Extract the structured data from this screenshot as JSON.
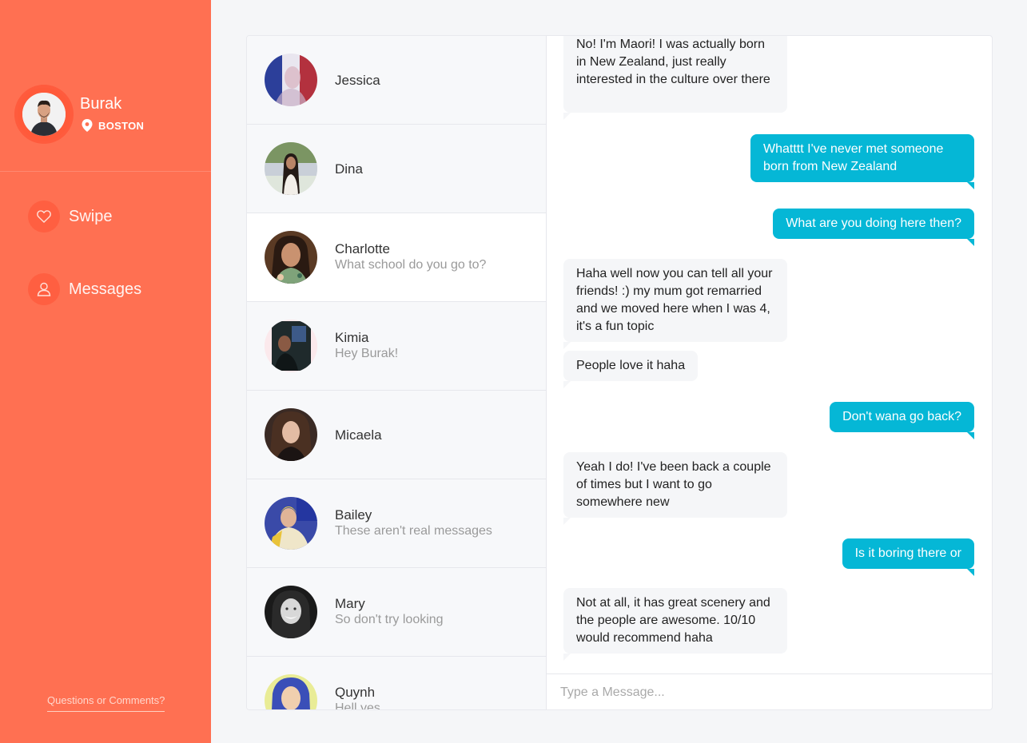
{
  "user": {
    "name": "Burak",
    "location": "BOSTON"
  },
  "nav": {
    "swipe_label": "Swipe",
    "messages_label": "Messages"
  },
  "footer": {
    "feedback_label": "Questions or Comments?"
  },
  "conversations": [
    {
      "name": "Jessica",
      "preview": ""
    },
    {
      "name": "Dina",
      "preview": ""
    },
    {
      "name": "Charlotte",
      "preview": "What school do you go to?"
    },
    {
      "name": "Kimia",
      "preview": "Hey Burak!"
    },
    {
      "name": "Micaela",
      "preview": ""
    },
    {
      "name": "Bailey",
      "preview": "These aren't real messages"
    },
    {
      "name": "Mary",
      "preview": "So don't try looking"
    },
    {
      "name": "Quynh",
      "preview": "Hell yes"
    }
  ],
  "messages": [
    {
      "from": "them",
      "text": "No! I'm Maori! I was actually born in New Zealand, just really interested in the culture over there"
    },
    {
      "from": "me",
      "text": "Whatttt I've never met someone born from New Zealand"
    },
    {
      "from": "me",
      "text": "What are you doing here then?"
    },
    {
      "from": "them",
      "text": "Haha well now you can tell all your friends! :) my mum got remarried and we moved here when I was 4, it's a fun topic"
    },
    {
      "from": "them",
      "text": "People love it haha"
    },
    {
      "from": "me",
      "text": "Don't wana go back?"
    },
    {
      "from": "them",
      "text": "Yeah I do! I've been back a couple of times but I want to go somewhere new"
    },
    {
      "from": "me",
      "text": "Is it boring there or"
    },
    {
      "from": "them",
      "text": "Not at all, it has great scenery and the people are awesome. 10/10 would recommend haha"
    }
  ],
  "composer": {
    "placeholder": "Type a Message..."
  },
  "colors": {
    "sidebar": "#ff7052",
    "accent_out": "#05b7d6",
    "bubble_in": "#f5f6f8"
  }
}
